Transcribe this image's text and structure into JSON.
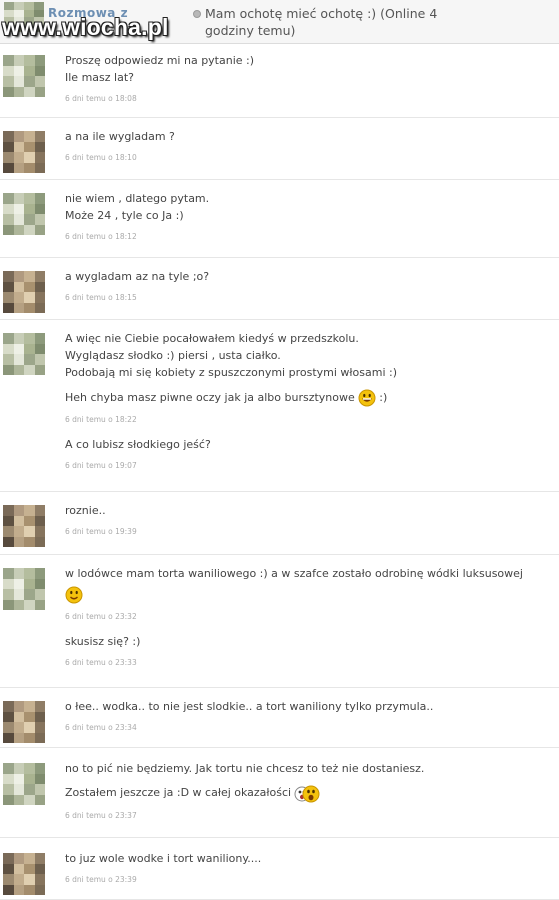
{
  "header": {
    "conversation_label": "Rozmowa z",
    "status_text": "Mam ochotę mieć ochotę :) (Online 4 godziny temu)",
    "watermark": "www.wiocha.pl"
  },
  "colors": {
    "header_bg": "#f6f6f6",
    "label_blue": "#6d8fb3",
    "divider": "#e6e6e6",
    "timestamp": "#aaaaaa",
    "text": "#444444"
  },
  "avatars": {
    "user_a": "pixelated-avatar-green",
    "user_b": "pixelated-avatar-tan"
  },
  "messages": [
    {
      "avatar": "user_a",
      "blocks": [
        {
          "lines": [
            "Proszę odpowiedz mi na pytanie :)",
            "Ile masz lat?"
          ],
          "time": "6 dni temu o 18:08"
        }
      ]
    },
    {
      "avatar": "user_b",
      "blocks": [
        {
          "lines": [
            "a na ile wygladam ?"
          ],
          "time": "6 dni temu o 18:10"
        }
      ]
    },
    {
      "avatar": "user_a",
      "blocks": [
        {
          "lines": [
            "nie wiem , dlatego pytam.",
            "Może 24 , tyle co Ja :)"
          ],
          "time": "6 dni temu o 18:12"
        }
      ]
    },
    {
      "avatar": "user_b",
      "blocks": [
        {
          "lines": [
            "a wygladam az na tyle ;o?"
          ],
          "time": "6 dni temu o 18:15"
        }
      ]
    },
    {
      "avatar": "user_a",
      "blocks": [
        {
          "lines": [
            "A więc nie Ciebie pocałowałem kiedyś w przedszkolu.",
            "Wyglądasz słodko :) piersi , usta ciałko.",
            "Podobają mi się kobiety z spuszczonymi prostymi włosami :)"
          ]
        },
        {
          "lines": [
            "Heh chyba masz piwne oczy jak ja albo bursztynowe"
          ],
          "emoji": "laughing-emoji",
          "suffix": " :)",
          "time": "6 dni temu o 18:22"
        },
        {
          "lines": [
            "A co lubisz słodkiego jeść?"
          ],
          "time": "6 dni temu o 19:07"
        }
      ]
    },
    {
      "avatar": "user_b",
      "blocks": [
        {
          "lines": [
            "roznie.."
          ],
          "time": "6 dni temu o 19:39"
        }
      ]
    },
    {
      "avatar": "user_a",
      "blocks": [
        {
          "lines": [
            "w lodówce mam torta waniliowego :) a w szafce zostało odrobinę wódki luksusowej"
          ],
          "emoji_line": "smiley-emoji",
          "time": "6 dni temu o 23:32"
        },
        {
          "lines": [
            "skusisz się? :)"
          ],
          "time": "6 dni temu o 23:33"
        }
      ]
    },
    {
      "avatar": "user_b",
      "blocks": [
        {
          "lines": [
            "o łee.. wodka.. to nie jest slodkie.. a tort waniliony tylko przymula.."
          ],
          "time": "6 dni temu o 23:34"
        }
      ]
    },
    {
      "avatar": "user_a",
      "blocks": [
        {
          "lines": [
            "no to pić nie będziemy. Jak tortu nie chcesz to też nie dostaniesz."
          ]
        },
        {
          "lines": [
            "Zostałem jeszcze ja :D w całej okazałości"
          ],
          "emoji": "surprised-emoji",
          "time": "6 dni temu o 23:37"
        }
      ]
    },
    {
      "avatar": "user_b",
      "blocks": [
        {
          "lines": [
            "to juz wole wodke i tort waniliony...."
          ],
          "time": "6 dni temu o 23:39"
        }
      ]
    }
  ]
}
